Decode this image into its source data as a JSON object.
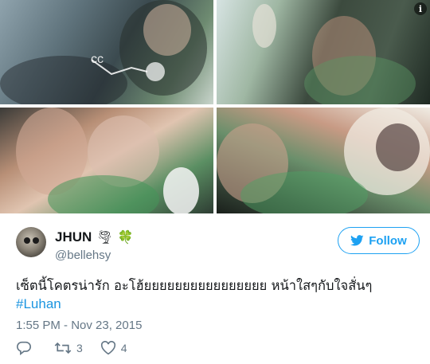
{
  "media": {
    "photos": [
      {
        "name": "photo-top-left",
        "description": ""
      },
      {
        "name": "photo-top-right",
        "description": ""
      },
      {
        "name": "photo-bottom-left",
        "description": ""
      },
      {
        "name": "photo-bottom-right",
        "description": ""
      }
    ],
    "info_icon": "i"
  },
  "user": {
    "display_name": "JHUN",
    "emoji_1": "🌪",
    "emoji_2": "🍀",
    "handle": "@bellehsy"
  },
  "follow": {
    "label": "Follow"
  },
  "tweet": {
    "text": "เซ็ตนี้โคตรน่ารัก อะโฮ้ยยยยยยยยยยยยยยยย หน้าใสๆกับใจสั่นๆ",
    "hashtag": "#Luhan",
    "timestamp": "1:55 PM - Nov 23, 2015"
  },
  "actions": {
    "reply_count": "",
    "retweet_count": "3",
    "like_count": "4"
  },
  "colors": {
    "accent": "#1da1f2",
    "hashtag": "#1b95e0",
    "secondary_text": "#657786",
    "primary_text": "#14171a"
  }
}
